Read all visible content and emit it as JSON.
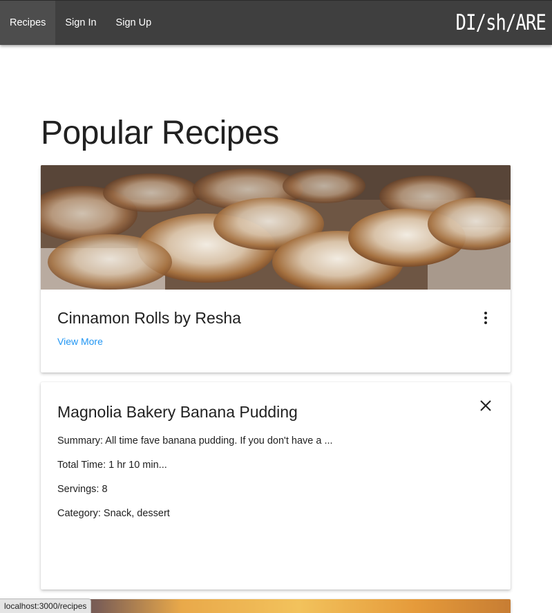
{
  "nav": {
    "items": [
      {
        "label": "Recipes",
        "active": true
      },
      {
        "label": "Sign In",
        "active": false
      },
      {
        "label": "Sign Up",
        "active": false
      }
    ],
    "brand": "DI/sh/ARE"
  },
  "page": {
    "title": "Popular Recipes"
  },
  "recipes": [
    {
      "title": "Cinnamon Rolls by Resha",
      "view_more": "View More",
      "menu_icon": "more-vert-icon"
    },
    {
      "title": "Magnolia Bakery Banana Pudding",
      "summary": "Summary: All time fave banana pudding. If you don't have a ...",
      "total_time": "Total Time: 1 hr 10 min...",
      "servings": "Servings: 8",
      "category": "Category: Snack, dessert",
      "close_icon": "close-icon"
    }
  ],
  "status_bar": {
    "url": "localhost:3000/recipes"
  },
  "colors": {
    "navbar": "#3f3f3f",
    "link": "#2196f3"
  }
}
